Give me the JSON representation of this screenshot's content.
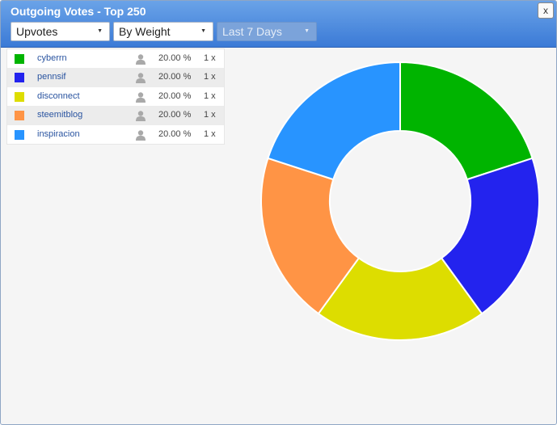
{
  "window": {
    "title": "Outgoing Votes - Top 250",
    "close_label": "x"
  },
  "toolbar": {
    "vote_type": "Upvotes",
    "sort_by": "By Weight",
    "period": "Last 7 Days"
  },
  "legend": {
    "rows": [
      {
        "name": "cyberrn",
        "percent": "20.00 %",
        "count": "1 x",
        "color": "#00b400"
      },
      {
        "name": "pennsif",
        "percent": "20.00 %",
        "count": "1 x",
        "color": "#2323ee"
      },
      {
        "name": "disconnect",
        "percent": "20.00 %",
        "count": "1 x",
        "color": "#dddd00"
      },
      {
        "name": "steemitblog",
        "percent": "20.00 %",
        "count": "1 x",
        "color": "#ff9445"
      },
      {
        "name": "inspiracion",
        "percent": "20.00 %",
        "count": "1 x",
        "color": "#2894ff"
      }
    ]
  },
  "chart_data": {
    "type": "pie",
    "variant": "donut",
    "categories": [
      "cyberrn",
      "pennsif",
      "disconnect",
      "steemitblog",
      "inspiracion"
    ],
    "values": [
      20,
      20,
      20,
      20,
      20
    ],
    "colors": [
      "#00b400",
      "#2323ee",
      "#dddd00",
      "#ff9445",
      "#2894ff"
    ]
  }
}
